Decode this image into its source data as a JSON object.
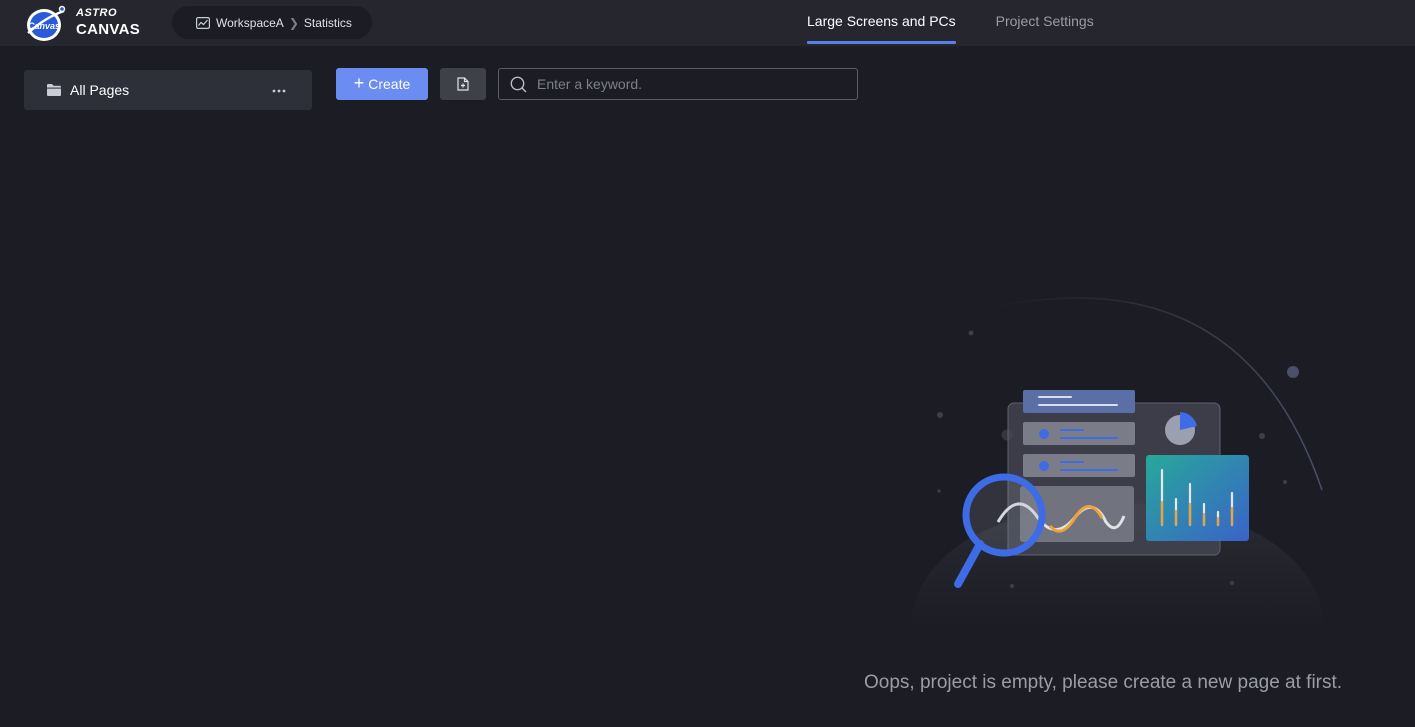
{
  "app": {
    "logo_line1": "ASTRO",
    "logo_line2": "CANVAS",
    "logo_badge_text": "Canvas"
  },
  "breadcrumb": {
    "workspace": "WorkspaceA",
    "project": "Statistics"
  },
  "tabs": [
    {
      "label": "Large Screens and PCs",
      "active": true
    },
    {
      "label": "Project Settings",
      "active": false
    }
  ],
  "sidebar": {
    "items": [
      {
        "label": "All Pages"
      }
    ]
  },
  "toolbar": {
    "create_label": "Create",
    "search_placeholder": "Enter a keyword."
  },
  "empty_state": {
    "message": "Oops, project is empty, please create a new page at first."
  },
  "colors": {
    "accent": "#5b7ee8",
    "primary_button": "#6b8cf0",
    "background": "#1b1c24",
    "topbar": "#25262e"
  },
  "icons": {
    "breadcrumb": "chart-line-icon",
    "sidebar_item": "folder-icon",
    "sidebar_more": "more-horizontal-icon",
    "create": "plus-icon",
    "import": "file-import-icon",
    "search": "search-icon"
  }
}
